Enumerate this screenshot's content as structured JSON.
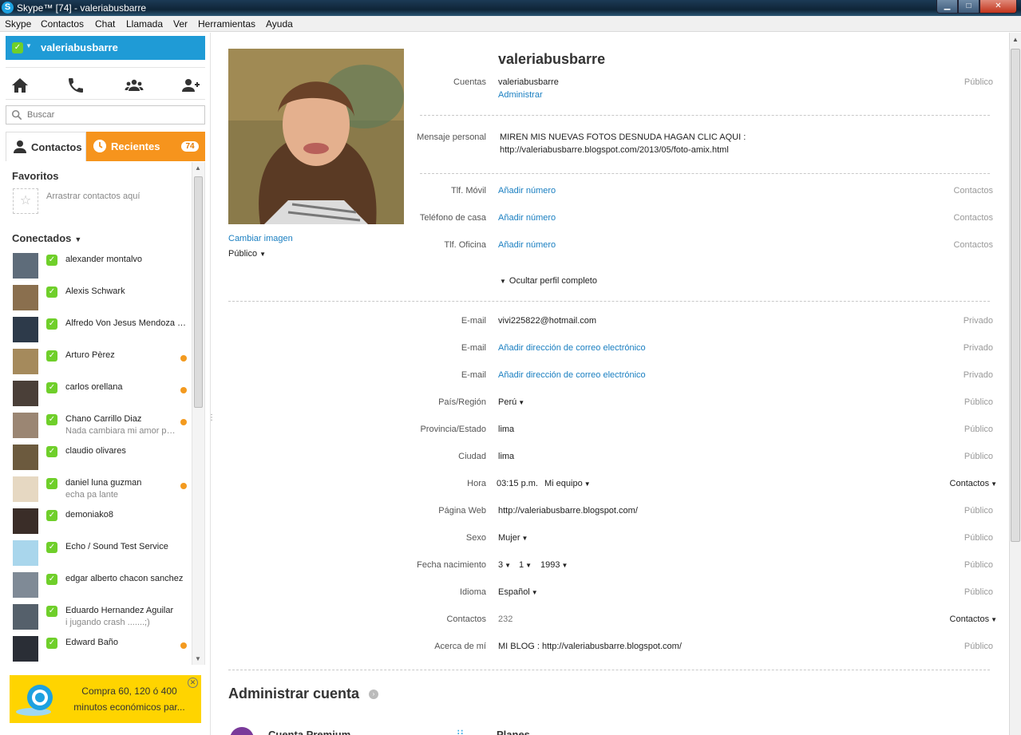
{
  "window": {
    "title": "Skype™ [74] - valeriabusbarre",
    "app_icon": "S",
    "minimize_glyph": "▁",
    "maximize_glyph": "□",
    "close_glyph": "✕"
  },
  "menu": [
    "Skype",
    "Contactos",
    "Chat",
    "Llamada",
    "Ver",
    "Herramientas",
    "Ayuda"
  ],
  "user": {
    "name": "valeriabusbarre",
    "status_color": "#6fcf2a"
  },
  "search": {
    "placeholder": "Buscar"
  },
  "tabs": {
    "contacts": "Contactos",
    "recent": "Recientes",
    "recent_count": "74"
  },
  "favorites": {
    "title": "Favoritos",
    "hint": "Arrastrar contactos aquí"
  },
  "online": {
    "title": "Conectados"
  },
  "contacts": [
    {
      "name": "alexander montalvo",
      "mood": "",
      "dot": false
    },
    {
      "name": "Alexis Schwark",
      "mood": "",
      "dot": false
    },
    {
      "name": "Alfredo Von Jesus Mendoza C...",
      "mood": "",
      "dot": false
    },
    {
      "name": "Arturo Pèrez",
      "mood": "",
      "dot": true
    },
    {
      "name": "carlos orellana",
      "mood": "",
      "dot": true
    },
    {
      "name": "Chano Carrillo Diaz",
      "mood": "Nada cambiara mi amor po...",
      "dot": true
    },
    {
      "name": "claudio olivares",
      "mood": "",
      "dot": false
    },
    {
      "name": "daniel luna guzman",
      "mood": "echa pa lante",
      "dot": true
    },
    {
      "name": "demoniako8",
      "mood": "",
      "dot": false
    },
    {
      "name": "Echo / Sound Test Service",
      "mood": "",
      "dot": false
    },
    {
      "name": "edgar alberto chacon sanchez",
      "mood": "",
      "dot": false
    },
    {
      "name": "Eduardo Hernandez Aguilar",
      "mood": "i jugando crash .......;)",
      "dot": false
    },
    {
      "name": "Edward Baño",
      "mood": "",
      "dot": true
    }
  ],
  "promo": {
    "text": "Compra 60, 120 ó 400 minutos económicos par..."
  },
  "profile": {
    "name": "valeriabusbarre",
    "change_image": "Cambiar imagen",
    "photo_visibility": "Público",
    "account": {
      "label": "Cuentas",
      "value": "valeriabusbarre",
      "manage": "Administrar",
      "visibility": "Público"
    },
    "mood": {
      "label": "Mensaje personal",
      "line1": "MIREN MIS NUEVAS FOTOS DESNUDA HAGAN CLIC AQUI :",
      "line2": "http://valeriabusbarre.blogspot.com/2013/05/foto-amix.html"
    },
    "phones": [
      {
        "label": "Tlf. Móvil",
        "value": "Añadir número",
        "visibility": "Contactos"
      },
      {
        "label": "Teléfono de casa",
        "value": "Añadir número",
        "visibility": "Contactos"
      },
      {
        "label": "Tlf. Oficina",
        "value": "Añadir número",
        "visibility": "Contactos"
      }
    ],
    "hide_full": "Ocultar perfil completo",
    "details": [
      {
        "label": "E-mail",
        "value": "vivi225822@hotmail.com",
        "visibility": "Privado"
      },
      {
        "label": "E-mail",
        "value": "Añadir dirección de correo electrónico",
        "visibility": "Privado"
      },
      {
        "label": "E-mail",
        "value": "Añadir dirección de correo electrónico",
        "visibility": "Privado"
      },
      {
        "label": "País/Región",
        "value": "Perú",
        "visibility": "Público"
      },
      {
        "label": "Provincia/Estado",
        "value": "lima",
        "visibility": "Público"
      },
      {
        "label": "Ciudad",
        "value": "lima",
        "visibility": "Público"
      },
      {
        "label": "Hora",
        "value": "03:15 p.m.",
        "extra": "Mi equipo",
        "visibility": "Contactos"
      },
      {
        "label": "Página Web",
        "value": "http://valeriabusbarre.blogspot.com/",
        "visibility": "Público"
      },
      {
        "label": "Sexo",
        "value": "Mujer",
        "visibility": "Público"
      },
      {
        "label": "Fecha nacimiento",
        "day": "3",
        "month": "1",
        "year": "1993",
        "visibility": "Público"
      },
      {
        "label": "Idioma",
        "value": "Español",
        "visibility": "Público"
      },
      {
        "label": "Contactos",
        "value": "232",
        "visibility": "Contactos"
      },
      {
        "label": "Acerca de mí",
        "value": "MI BLOG : http://valeriabusbarre.blogspot.com/",
        "visibility": "Público"
      }
    ],
    "admin_title": "Administrar cuenta",
    "premium": "Cuenta Premium",
    "plans": "Planes"
  },
  "colors": {
    "brand_blue": "#1f9bd6",
    "recent_orange": "#f6941d",
    "link": "#1a7fc1",
    "online_green": "#6fcf2a",
    "promo_yellow": "#ffd400"
  }
}
